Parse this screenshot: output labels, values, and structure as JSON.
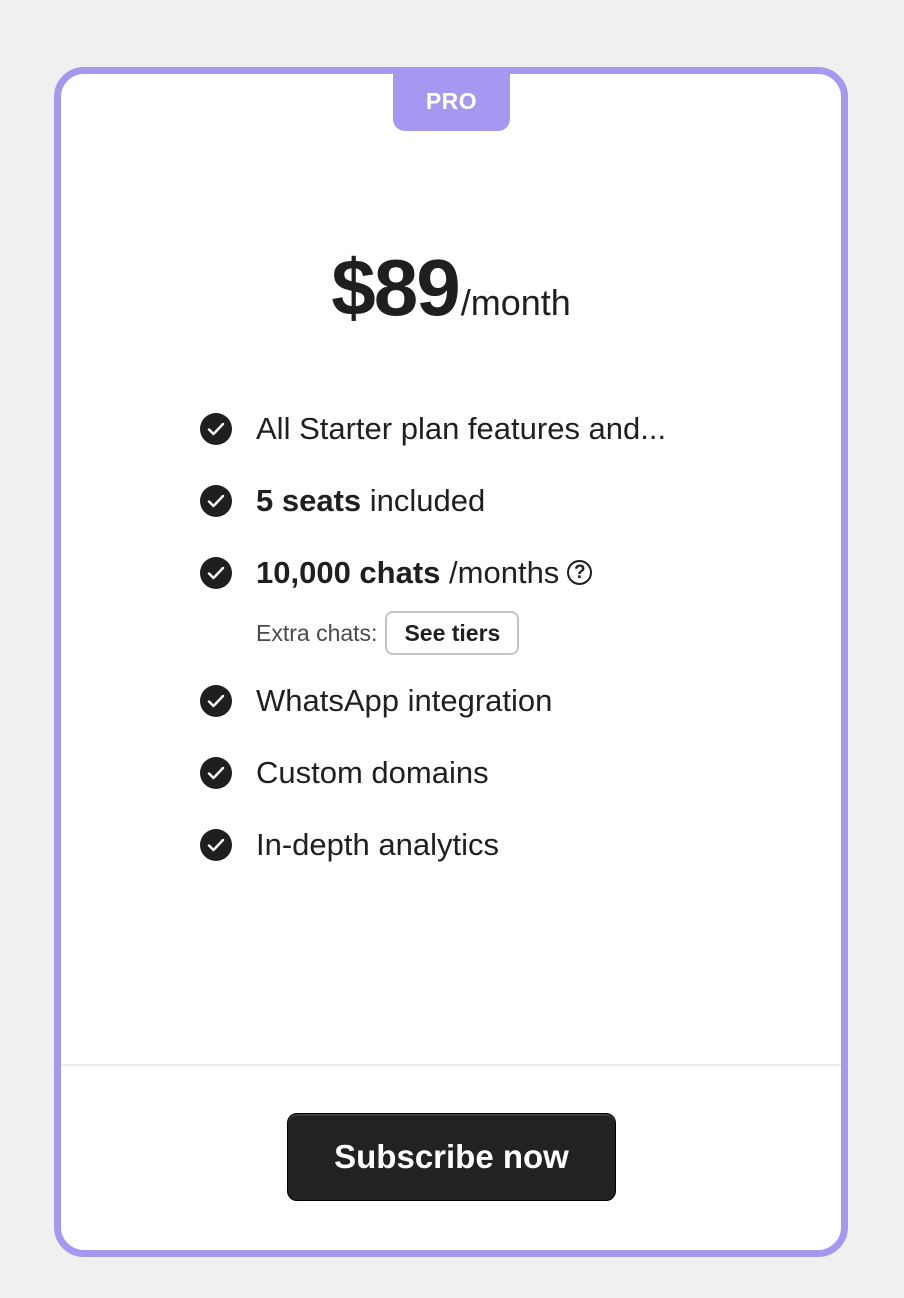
{
  "plan": {
    "badge": "PRO",
    "price": "$89",
    "period": "/month"
  },
  "features": [
    {
      "bold": "",
      "text": "All Starter plan features and...",
      "icon": "check-circle-icon"
    },
    {
      "bold": "5 seats",
      "text": " included",
      "icon": "check-circle-icon"
    },
    {
      "bold": "10,000 chats",
      "text": " /months",
      "icon": "check-circle-icon"
    },
    {
      "bold": "",
      "text": "WhatsApp integration",
      "icon": "check-circle-icon"
    },
    {
      "bold": "",
      "text": "Custom domains",
      "icon": "check-circle-icon"
    },
    {
      "bold": "",
      "text": "In-depth analytics",
      "icon": "check-circle-icon"
    }
  ],
  "extra_chats": {
    "label": "Extra chats:",
    "button_label": "See tiers"
  },
  "help_icon_glyph": "?",
  "cta": {
    "label": "Subscribe now"
  },
  "colors": {
    "accent": "#a598f1",
    "background": "#f0f0f0",
    "button": "#222222",
    "text": "#1f1f1f"
  }
}
